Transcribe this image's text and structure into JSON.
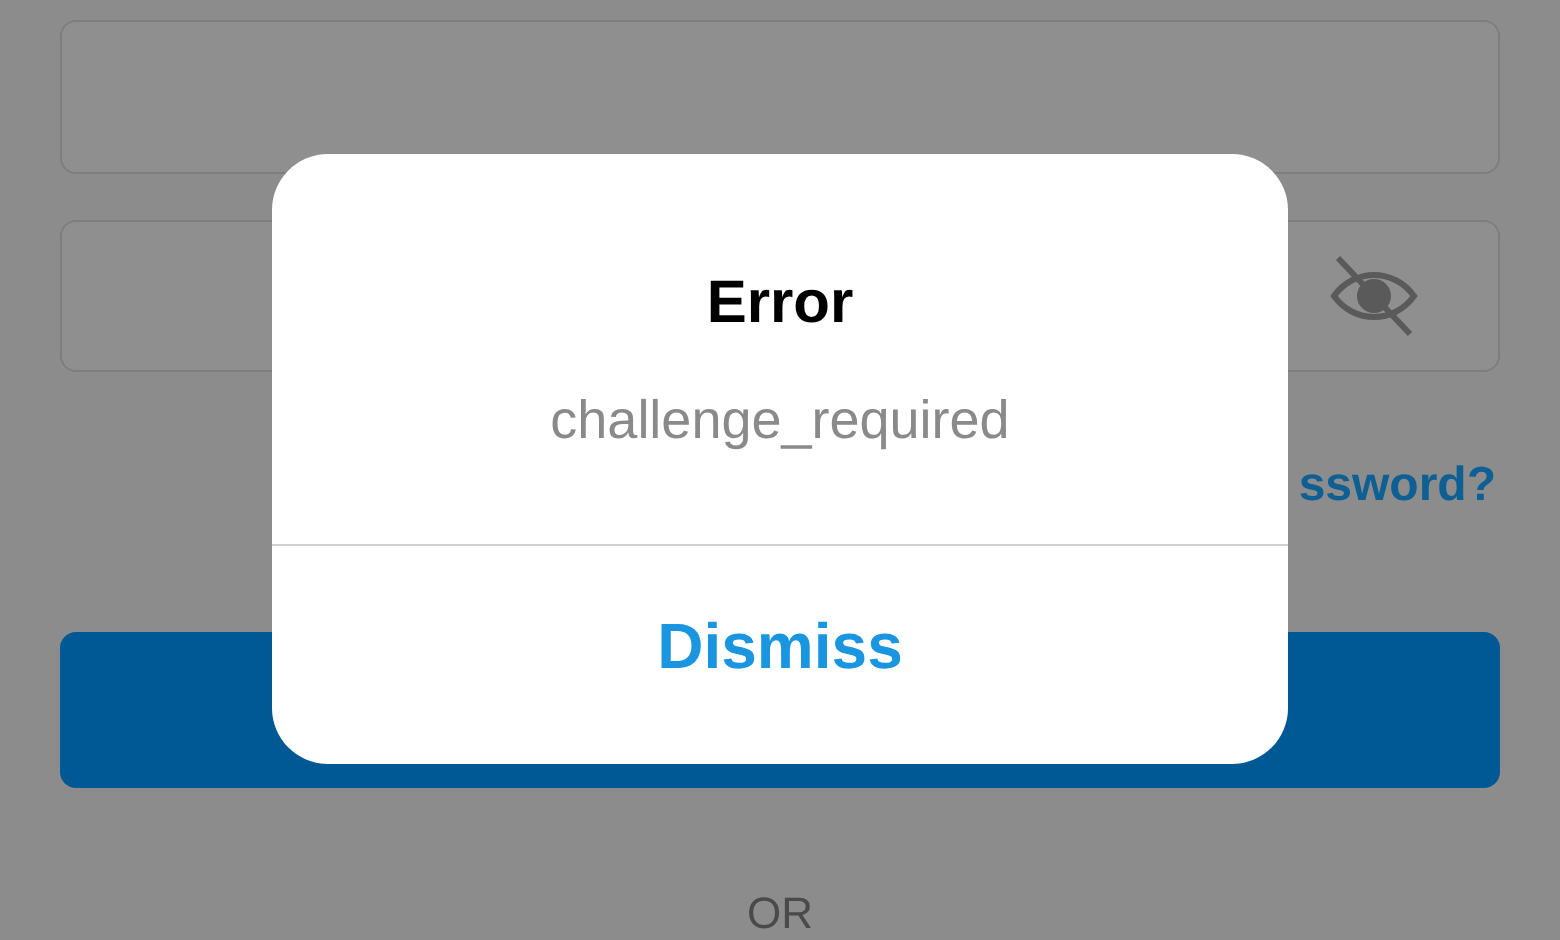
{
  "login_form": {
    "fields": [
      {
        "kind": "text"
      },
      {
        "kind": "password"
      }
    ],
    "forgot_link": "ssword?",
    "divider_text": "OR"
  },
  "alert": {
    "title": "Error",
    "message": "challenge_required",
    "buttons": [
      "Dismiss"
    ]
  }
}
